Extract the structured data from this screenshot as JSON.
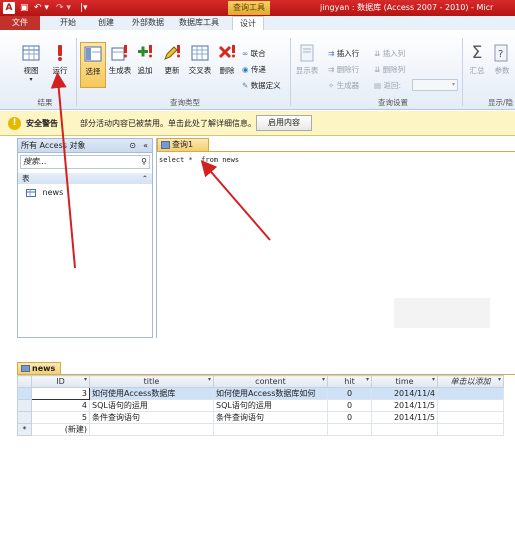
{
  "titlebar": {
    "app_icon": "A",
    "qa_save": "▣",
    "qa_undo": "↶ ▾",
    "qa_redo": "↷ ▾",
    "qa_more": "|▾",
    "context_tab": "查询工具",
    "window_title": "jingyan : 数据库 (Access 2007 - 2010) - Micr"
  },
  "tabs": [
    "文件",
    "开始",
    "创建",
    "外部数据",
    "数据库工具",
    "设计"
  ],
  "ribbon": {
    "results": {
      "view": "视图",
      "run": "运行",
      "label": "结果"
    },
    "query_type": {
      "select": "选择",
      "make_table": "生成表",
      "append": "追加",
      "update": "更新",
      "crosstab": "交叉表",
      "delete": "删除",
      "union": "联合",
      "pass_through": "传递",
      "data_def": "数据定义",
      "label": "查询类型"
    },
    "show_table": "显示表",
    "query_setup": {
      "insert_row": "插入行",
      "delete_row": "删除行",
      "builder": "生成器",
      "insert_col": "插入列",
      "delete_col": "删除列",
      "return": "返回:",
      "label": "查询设置"
    },
    "show_hide": {
      "totals": "汇总",
      "params": "参数",
      "label": "显示/隐"
    }
  },
  "security": {
    "title": "安全警告",
    "message": "部分活动内容已被禁用。单击此处了解详细信息。",
    "enable_button": "启用内容"
  },
  "nav": {
    "title": "所有 Access 对象",
    "search_placeholder": "搜索...",
    "category": "表",
    "item": "news"
  },
  "query": {
    "tab_label": "查询1",
    "sql": "select *  from news"
  },
  "datasheet": {
    "tab_label": "news",
    "columns": [
      "ID",
      "title",
      "content",
      "hit",
      "time",
      "单击以添加"
    ],
    "rows": [
      {
        "id": "3",
        "title": "如何使用Access数据库",
        "content": "如何使用Access数据库如何",
        "hit": "0",
        "time": "2014/11/4"
      },
      {
        "id": "4",
        "title": "SQL语句的运用",
        "content": "SQL语句的运用",
        "hit": "0",
        "time": "2014/11/5"
      },
      {
        "id": "5",
        "title": "条件查询语句",
        "content": "条件查询语句",
        "hit": "0",
        "time": "2014/11/5"
      }
    ],
    "new_row_marker": "*",
    "new_row_label": "(新建)"
  },
  "colors": {
    "arrow": "#d32020",
    "title_bar": "#c01c1c",
    "accent_tab": "#f3cf6e"
  }
}
